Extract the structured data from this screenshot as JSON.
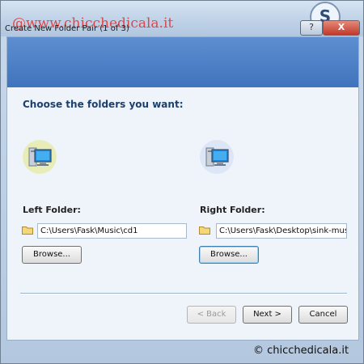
{
  "window": {
    "title": "Create New Folder Pair (1 of 3)",
    "help_label": "?",
    "close_label": "X"
  },
  "watermark": {
    "top": "@www.chicchedicala.it",
    "bottom": "© chicchedicala.it"
  },
  "heading": "Choose the folders you want:",
  "left": {
    "label": "Left Folder:",
    "path": "C:\\Users\\Fask\\Music\\cd1",
    "browse_label": "Browse..."
  },
  "right": {
    "label": "Right Folder:",
    "path": "C:\\Users\\Fask\\Desktop\\sink-mus",
    "browse_label": "Browse..."
  },
  "footer": {
    "back_label": "< Back",
    "next_label": "Next >",
    "cancel_label": "Cancel"
  },
  "colors": {
    "header_band": "#4a7fc6",
    "heading_text": "#1d3f6e"
  },
  "icons": [
    "computer-icon",
    "folder-icon",
    "sync-logo-icon"
  ]
}
